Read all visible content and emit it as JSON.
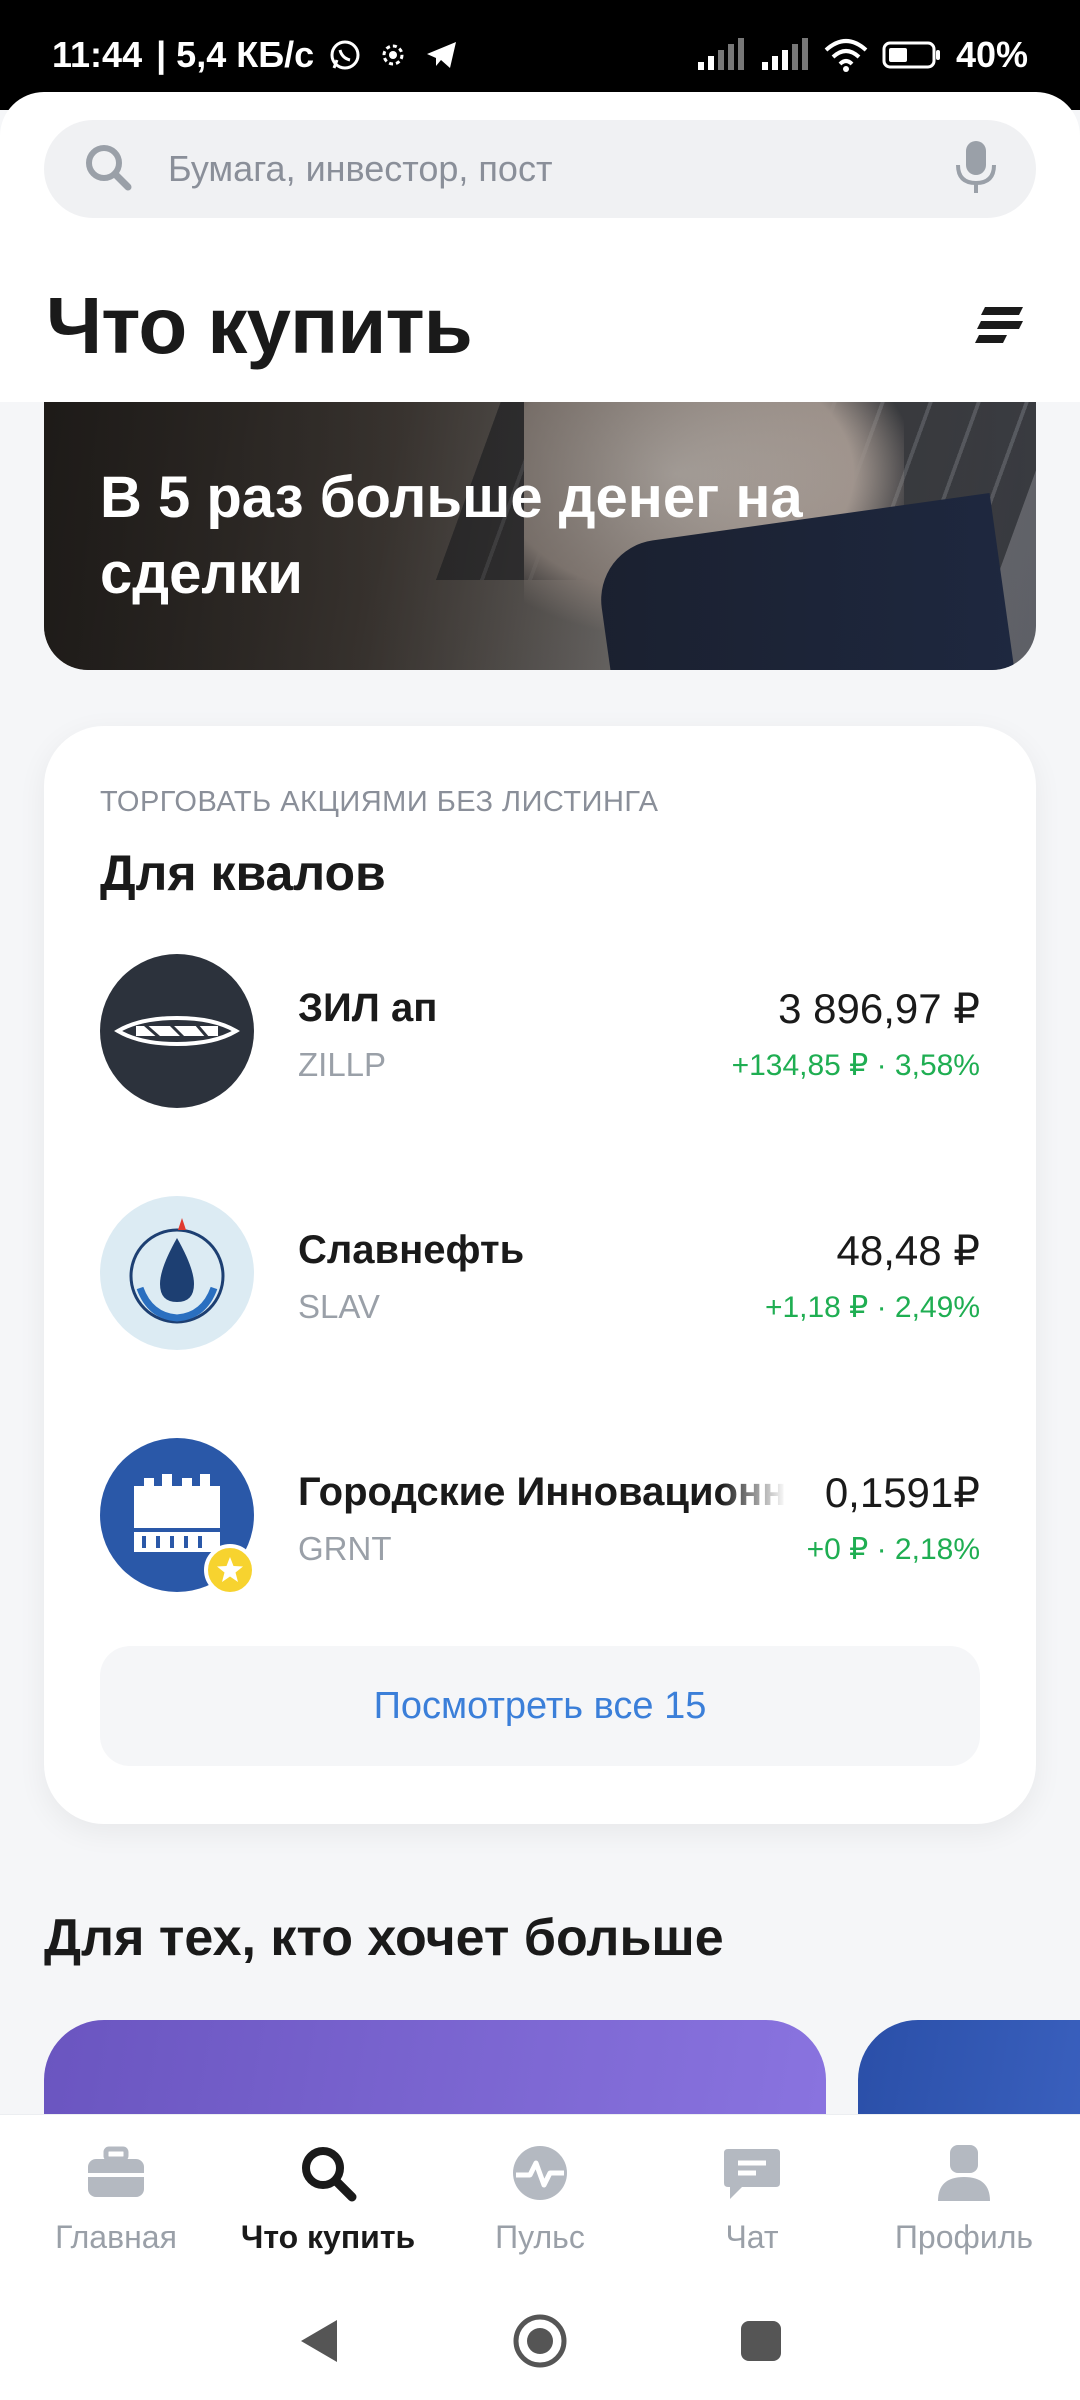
{
  "status_bar": {
    "time": "11:44",
    "speed": "| 5,4 КБ/с",
    "battery": "40%"
  },
  "search": {
    "placeholder": "Бумага, инвестор, пост"
  },
  "header": {
    "title": "Что купить"
  },
  "banner": {
    "text": "В 5 раз больше денег на сделки"
  },
  "kval_card": {
    "overline": "ТОРГОВАТЬ АКЦИЯМИ БЕЗ ЛИСТИНГА",
    "title": "Для квалов",
    "items": [
      {
        "name": "ЗИЛ ап",
        "ticker": "ZILLP",
        "price": "3 896,97 ₽",
        "change": "+134,85 ₽ · 3,58%"
      },
      {
        "name": "Славнефть",
        "ticker": "SLAV",
        "price": "48,48 ₽",
        "change": "+1,18 ₽ · 2,49%"
      },
      {
        "name": "Городские Инновационные",
        "ticker": "GRNT",
        "price": "0,1591₽",
        "change": "+0 ₽ · 2,18%"
      }
    ],
    "see_all": "Посмотреть все 15"
  },
  "section": {
    "title": "Для тех, кто хочет больше"
  },
  "bottom_nav": [
    {
      "label": "Главная",
      "icon": "briefcase-icon",
      "active": false
    },
    {
      "label": "Что купить",
      "icon": "search-icon",
      "active": true
    },
    {
      "label": "Пульс",
      "icon": "pulse-icon",
      "active": false
    },
    {
      "label": "Чат",
      "icon": "chat-icon",
      "active": false
    },
    {
      "label": "Профиль",
      "icon": "profile-icon",
      "active": false
    }
  ],
  "colors": {
    "accent_link": "#3b7fd9",
    "positive": "#1fae52",
    "promo_purple": "#7a64d2",
    "promo_blue": "#2a4fa8"
  }
}
